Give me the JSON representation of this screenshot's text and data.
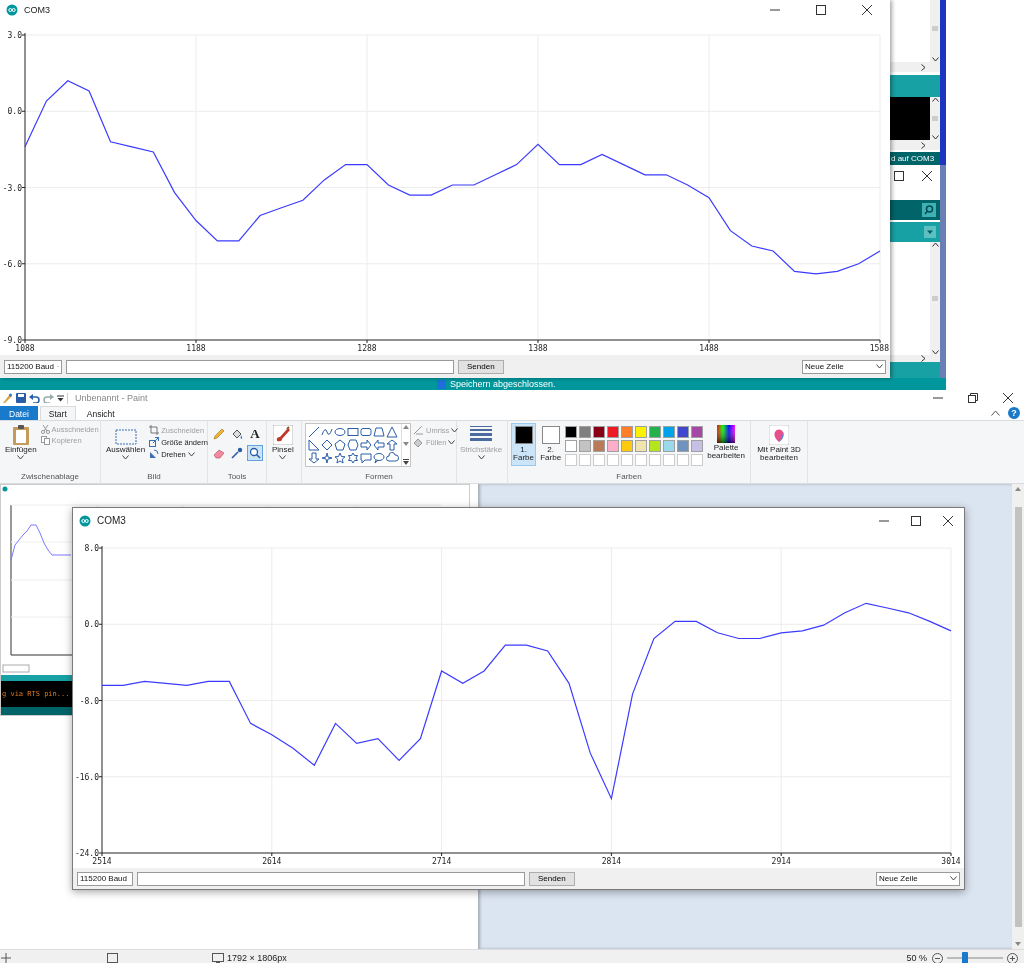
{
  "top_plotter": {
    "title": "COM3",
    "chart_data": {
      "type": "line",
      "xlim": [
        1088,
        1588
      ],
      "ylim": [
        -9,
        3
      ],
      "xticks": [
        1088,
        1188,
        1288,
        1388,
        1488,
        1588
      ],
      "yticks": [
        {
          "value": 3,
          "label": "3.0"
        },
        {
          "value": 0,
          "label": "0.0"
        },
        {
          "value": -3,
          "label": "-3.0"
        },
        {
          "value": -6,
          "label": "-6.0"
        },
        {
          "value": -9,
          "label": "-9.0"
        }
      ],
      "x": [
        1088,
        1100.5,
        1113,
        1125.5,
        1138,
        1150.5,
        1163,
        1175.5,
        1188,
        1200.5,
        1213,
        1225.5,
        1238,
        1250.5,
        1263,
        1275.5,
        1288,
        1300.5,
        1313,
        1325.5,
        1338,
        1350.5,
        1363,
        1375.5,
        1388,
        1400.5,
        1413,
        1425.5,
        1438,
        1450.5,
        1463,
        1475.5,
        1488,
        1500.5,
        1513,
        1525.5,
        1538,
        1550.5,
        1563,
        1575.5,
        1588
      ],
      "grid": true,
      "series": [
        {
          "color": "#3b3bff",
          "values": [
            -1.4,
            0.4,
            1.2,
            0.8,
            -1.2,
            -1.4,
            -1.6,
            -3.2,
            -4.3,
            -5.1,
            -5.1,
            -4.1,
            -3.8,
            -3.5,
            -2.7,
            -2.1,
            -2.1,
            -2.9,
            -3.3,
            -3.3,
            -2.9,
            -2.9,
            -2.5,
            -2.1,
            -1.3,
            -2.1,
            -2.1,
            -1.7,
            -2.1,
            -2.5,
            -2.5,
            -2.9,
            -3.4,
            -4.7,
            -5.3,
            -5.5,
            -6.3,
            -6.4,
            -6.3,
            -6.0,
            -5.5
          ]
        }
      ]
    },
    "baud": "115200 Baud",
    "send_button": "Senden",
    "line_ending": "Neue Zeile"
  },
  "background_ide": {
    "port_status": "d auf COM3",
    "message": "Speichern abgeschlossen."
  },
  "paint": {
    "title": "Unbenannt - Paint",
    "tabs": [
      {
        "label": "Datei",
        "kind": "file",
        "selected": false
      },
      {
        "label": "Start",
        "kind": "tab",
        "selected": true
      },
      {
        "label": "Ansicht",
        "kind": "tab",
        "selected": false
      }
    ],
    "help_glyph": "?",
    "clipboard": {
      "label": "Zwischenablage",
      "paste": "Einfügen",
      "items": [
        {
          "label": "Ausschneiden",
          "disabled": true
        },
        {
          "label": "Kopieren",
          "disabled": true
        }
      ]
    },
    "image": {
      "label": "Bild",
      "select": "Auswählen",
      "items": [
        {
          "label": "Zuschneiden",
          "disabled": true
        },
        {
          "label": "Größe ändern",
          "disabled": false
        },
        {
          "label": "Drehen",
          "disabled": false
        }
      ]
    },
    "tools": {
      "label": "Tools",
      "items": [
        {
          "kind": "pencil",
          "selected": false
        },
        {
          "kind": "fill",
          "selected": false
        },
        {
          "kind": "text",
          "glyph": "A",
          "selected": false
        },
        {
          "kind": "eraser",
          "selected": false
        },
        {
          "kind": "picker",
          "selected": false
        },
        {
          "kind": "magnifier",
          "selected": true
        }
      ]
    },
    "brush": "Pinsel",
    "shapes": {
      "label": "Formen",
      "outline": {
        "label": "Umriss",
        "disabled": true
      },
      "fill": {
        "label": "Füllen",
        "disabled": true
      }
    },
    "stroke": {
      "label": "Strichstärke",
      "disabled": true
    },
    "colors": {
      "label": "Farben",
      "slots": [
        {
          "label": "1. Farbe",
          "color": "#000000",
          "selected": true
        },
        {
          "label": "2. Farbe",
          "color": "#ffffff",
          "selected": false
        }
      ],
      "palette": [
        {
          "color": "#000000"
        },
        {
          "color": "#7f7f7f"
        },
        {
          "color": "#880015"
        },
        {
          "color": "#ed1c24"
        },
        {
          "color": "#ff7f27"
        },
        {
          "color": "#fff200"
        },
        {
          "color": "#22b14c"
        },
        {
          "color": "#00a2e8"
        },
        {
          "color": "#3f48cc"
        },
        {
          "color": "#a349a4"
        },
        {
          "color": "#ffffff"
        },
        {
          "color": "#c3c3c3"
        },
        {
          "color": "#b97a57"
        },
        {
          "color": "#ffaec9"
        },
        {
          "color": "#ffc90e"
        },
        {
          "color": "#efe4b0"
        },
        {
          "color": "#b5e61d"
        },
        {
          "color": "#99d9ea"
        },
        {
          "color": "#7092be"
        },
        {
          "color": "#c8bfe7"
        }
      ],
      "edit_palette": "Palette bearbeiten"
    },
    "paint3d": "Mit Paint 3D bearbeiten",
    "thumbnail": {
      "console_text": "g via RTS pin..."
    },
    "plotter": {
      "title": "COM3",
      "chart_data": {
        "type": "line",
        "xlim": [
          2514,
          3014
        ],
        "ylim": [
          -24,
          8
        ],
        "xticks": [
          2514,
          2614,
          2714,
          2814,
          2914,
          3014
        ],
        "yticks": [
          {
            "value": 8,
            "label": "8.0"
          },
          {
            "value": 0,
            "label": "0.0"
          },
          {
            "value": -8,
            "label": "-8.0"
          },
          {
            "value": -16,
            "label": "-16.0"
          },
          {
            "value": -24,
            "label": "-24.0"
          }
        ],
        "x": [
          2514,
          2526.5,
          2539,
          2551.5,
          2564,
          2576.5,
          2589,
          2601.5,
          2614,
          2626.5,
          2639,
          2651.5,
          2664,
          2676.5,
          2689,
          2701.5,
          2714,
          2726.5,
          2739,
          2751.5,
          2764,
          2776.5,
          2789,
          2801.5,
          2814,
          2826.5,
          2839,
          2851.5,
          2864,
          2876.5,
          2889,
          2901.5,
          2914,
          2926.5,
          2939,
          2951.5,
          2964,
          2976.5,
          2989,
          3001.5,
          3014
        ],
        "grid": true,
        "series": [
          {
            "color": "#3b3bff",
            "values": [
              -6.4,
              -6.4,
              -6.0,
              -6.2,
              -6.4,
              -6.0,
              -6.0,
              -10.4,
              -11.6,
              -13.0,
              -14.8,
              -10.4,
              -12.5,
              -12.0,
              -14.3,
              -12.0,
              -4.9,
              -6.2,
              -4.9,
              -2.2,
              -2.2,
              -2.8,
              -6.2,
              -13.5,
              -18.3,
              -7.3,
              -1.5,
              0.3,
              0.3,
              -0.9,
              -1.5,
              -1.5,
              -0.9,
              -0.7,
              -0.1,
              1.2,
              2.2,
              1.7,
              1.2,
              0.3,
              -0.7
            ]
          }
        ]
      },
      "baud": "115200 Baud",
      "send_button": "Senden",
      "line_ending": "Neue Zeile"
    },
    "status": {
      "dimensions": "1792 × 1806px",
      "zoom": "50 %",
      "zoom_slider": {
        "level": 0.3
      }
    }
  }
}
